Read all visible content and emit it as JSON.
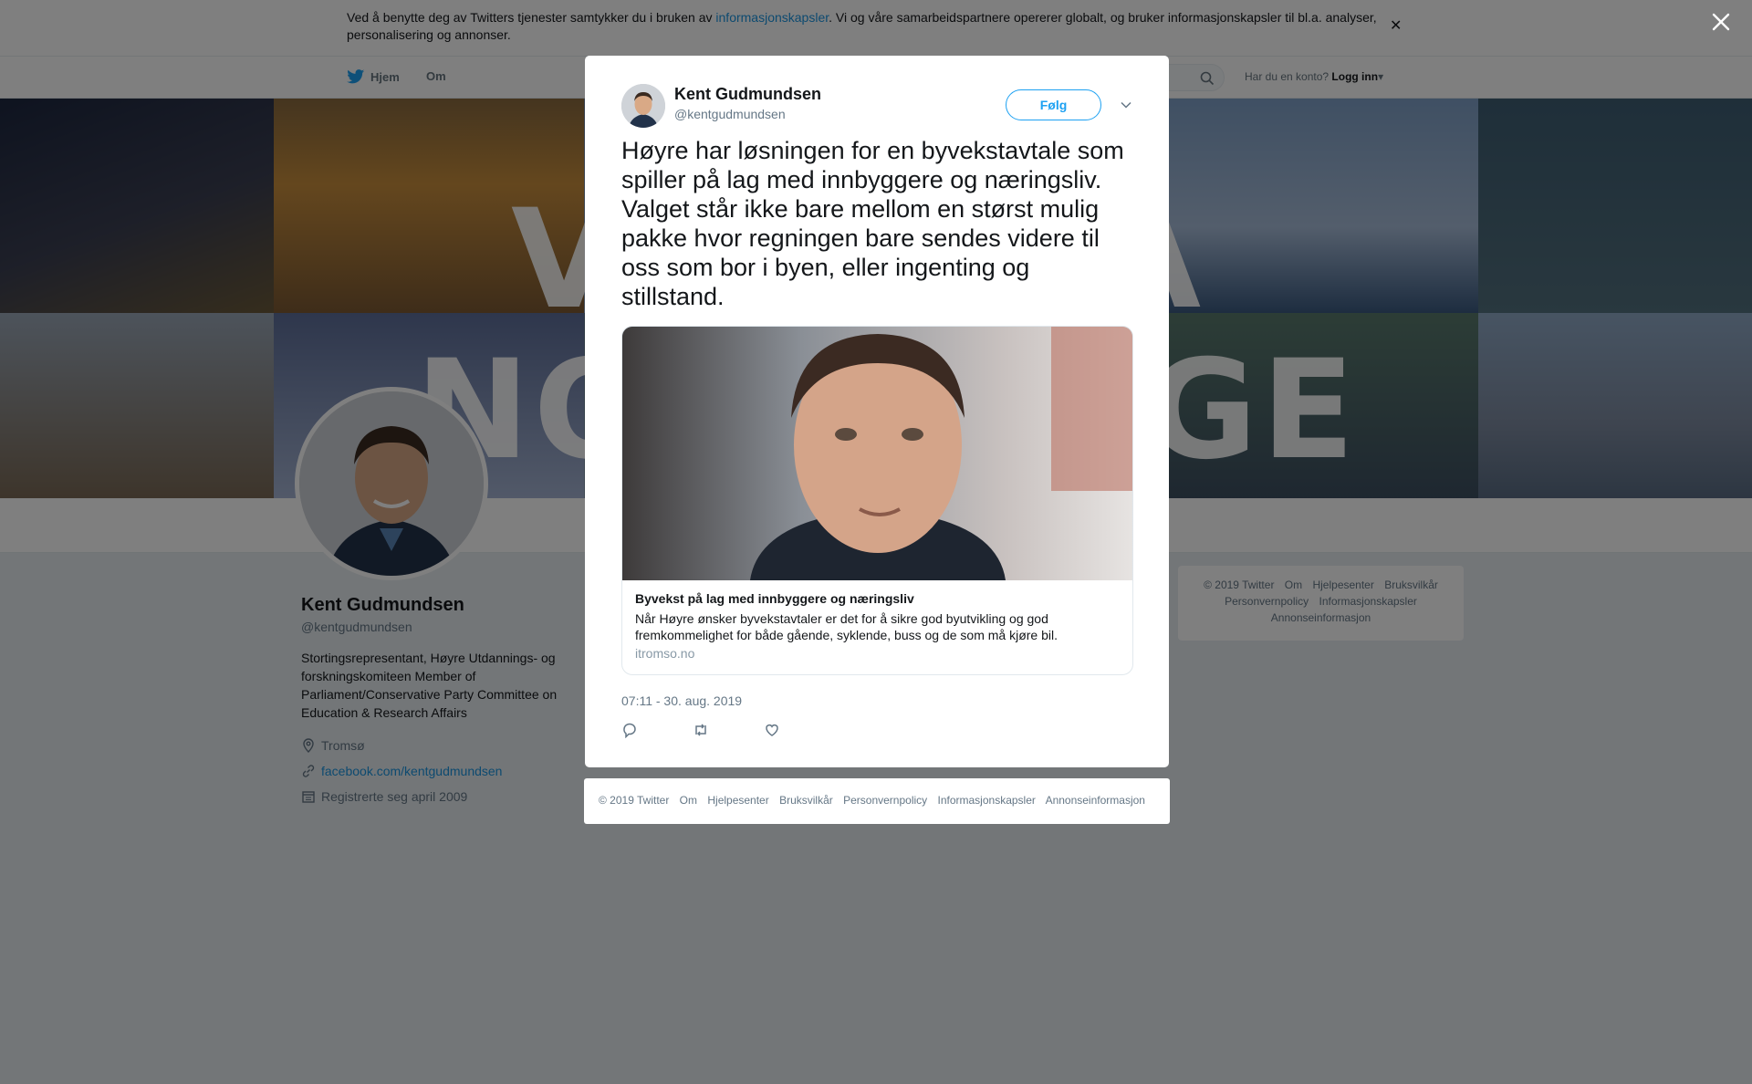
{
  "cookie_bar": {
    "text_before": "Ved å benytte deg av Twitters tjenester samtykker du i bruken av ",
    "link": "informasjonskapsler",
    "text_after": ". Vi og våre samarbeidspartnere opererer globalt, og bruker informasjonskapsler til bl.a. analyser, personalisering og annonser.",
    "close_icon": "close-icon"
  },
  "nav": {
    "home": "Hjem",
    "about": "Om",
    "account_prompt": "Har du en konto?",
    "login": "Logg inn"
  },
  "banner": {
    "words": [
      "V",
      "Å",
      "NO",
      "GE"
    ]
  },
  "profile": {
    "name": "Kent Gudmundsen",
    "handle": "@kentgudmundsen",
    "bio": "Stortingsrepresentant, Høyre Utdannings- og forskningskomiteen Member of Parliament/Conservative Party Committee on Education & Research Affairs",
    "location": "Tromsø",
    "website": "facebook.com/kentgudmundsen",
    "joined": "Registrerte seg april 2009"
  },
  "side_footer": {
    "items": [
      "© 2019 Twitter",
      "Om",
      "Hjelpesenter",
      "Bruksvilkår",
      "Personvernpolicy",
      "Informasjonskapsler",
      "Annonseinformasjon"
    ]
  },
  "tweet": {
    "author_name": "Kent Gudmundsen",
    "author_handle": "@kentgudmundsen",
    "follow_label": "Følg",
    "text": "Høyre har løsningen for en byvekstavtale som spiller på lag med innbyggere og næringsliv. Valget står ikke bare mellom en størst mulig pakke hvor regningen bare sendes videre til oss som bor i byen, eller ingenting og stillstand.",
    "card": {
      "title": "Byvekst på lag med innbyggere og næringsliv",
      "description": "Når Høyre ønsker byvekstavtaler er det for å sikre god byutvikling og god fremkommelighet for både gående, syklende, buss og de som må kjøre bil.",
      "domain": "itromso.no"
    },
    "timestamp": "07:11 - 30. aug. 2019"
  },
  "modal_footer": {
    "items": [
      "© 2019 Twitter",
      "Om",
      "Hjelpesenter",
      "Bruksvilkår",
      "Personvernpolicy",
      "Informasjonskapsler",
      "Annonseinformasjon"
    ]
  },
  "colors": {
    "accent": "#1da1f2",
    "link": "#1b95e0",
    "overlay": "rgba(0,0,0,0.5)"
  }
}
